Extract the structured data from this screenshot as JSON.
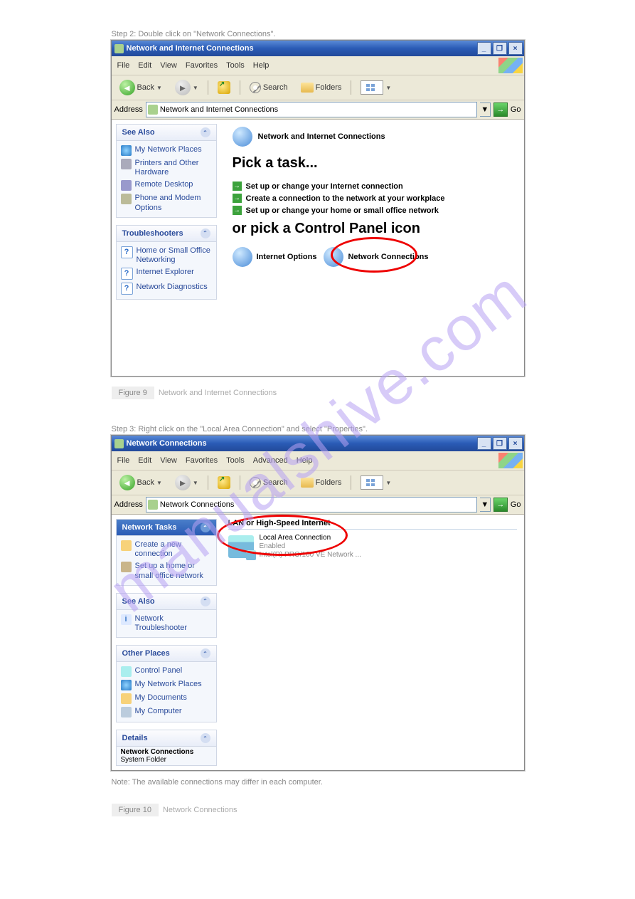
{
  "watermark": "manualshive.com",
  "doc": {
    "step2": "Step 2: Double click on \"Network Connections\".",
    "step3": "Step 3: Right click on the \"Local Area Connection\" and select \"Properties\".",
    "note": "Note: The available connections may differ in each computer."
  },
  "win1": {
    "title": "Network and Internet Connections",
    "menu": [
      "File",
      "Edit",
      "View",
      "Favorites",
      "Tools",
      "Help"
    ],
    "toolbar": {
      "back": "Back",
      "search": "Search",
      "folders": "Folders"
    },
    "address_label": "Address",
    "address_value": "Network and Internet Connections",
    "go": "Go",
    "panels": {
      "see_also": {
        "title": "See Also",
        "items": [
          "My Network Places",
          "Printers and Other Hardware",
          "Remote Desktop",
          "Phone and Modem Options"
        ]
      },
      "trouble": {
        "title": "Troubleshooters",
        "items": [
          "Home or Small Office Networking",
          "Internet Explorer",
          "Network Diagnostics"
        ]
      }
    },
    "main": {
      "header": "Network and Internet Connections",
      "pick_task": "Pick a task...",
      "tasks": [
        "Set up or change your Internet connection",
        "Create a connection to the network at your workplace",
        "Set up or change your home or small office network"
      ],
      "pick_icon": "or pick a Control Panel icon",
      "cp_icons": [
        "Internet Options",
        "Network Connections"
      ]
    }
  },
  "win2": {
    "title": "Network Connections",
    "menu": [
      "File",
      "Edit",
      "View",
      "Favorites",
      "Tools",
      "Advanced",
      "Help"
    ],
    "toolbar": {
      "back": "Back",
      "search": "Search",
      "folders": "Folders"
    },
    "address_label": "Address",
    "address_value": "Network Connections",
    "go": "Go",
    "panels": {
      "tasks": {
        "title": "Network Tasks",
        "items": [
          "Create a new connection",
          "Set up a home or small office network"
        ]
      },
      "see_also": {
        "title": "See Also",
        "items": [
          "Network Troubleshooter"
        ]
      },
      "other": {
        "title": "Other Places",
        "items": [
          "Control Panel",
          "My Network Places",
          "My Documents",
          "My Computer"
        ]
      },
      "details": {
        "title": "Details",
        "name": "Network Connections",
        "type": "System Folder"
      }
    },
    "main": {
      "category": "LAN or High-Speed Internet",
      "lan": {
        "name": "Local Area Connection",
        "status": "Enabled",
        "device": "Intel(R) PRO/100 VE Network ..."
      }
    }
  },
  "captions": [
    {
      "num": "Figure 9",
      "text": "Network and Internet Connections"
    },
    {
      "num": "Figure 10",
      "text": "Network Connections"
    }
  ]
}
